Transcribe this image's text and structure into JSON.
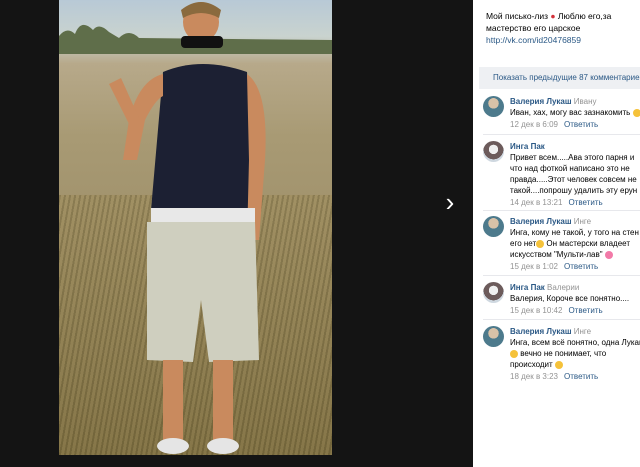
{
  "photo": {
    "alt": ""
  },
  "nav": {
    "next": "›"
  },
  "post": {
    "text_before": "Мой писько-лиз",
    "text_after": "Люблю его,за",
    "text_line2": "мастерство его царское",
    "link": "http://vk.com/id20476859"
  },
  "show_previous": "Показать предыдущие 87 комментариев",
  "comments": [
    {
      "author": "Валерия Лукаш",
      "reply_to": "Ивану",
      "lines": [
        "Иван, хах, могу вас зазнакомить"
      ],
      "date": "12 дек в 6:09",
      "reply": "Ответить"
    },
    {
      "author": "Инга Пак",
      "reply_to": "",
      "lines": [
        "Привет всем.....Ава этого парня и",
        "что над фоткой написано это не",
        "правда.....Этот человек совсем не",
        "такой....попрошу удалить эту ерун"
      ],
      "date": "14 дек в 13:21",
      "reply": "Ответить"
    },
    {
      "author": "Валерия Лукаш",
      "reply_to": "Инге",
      "lines": [
        "Инга, кому не такой, у того на стен",
        "его нет",
        "Он мастерски владеет",
        "искусством \"Мульти-лав\""
      ],
      "date": "15 дек в 1:02",
      "reply": "Ответить"
    },
    {
      "author": "Инга Пак",
      "reply_to": "Валерии",
      "lines": [
        "Валерия, Короче все понятно...."
      ],
      "date": "15 дек в 10:42",
      "reply": "Ответить"
    },
    {
      "author": "Валерия Лукаш",
      "reply_to": "Инге",
      "lines": [
        "Инга, всем всё понятно, одна Лукаш",
        "вечно не понимает, что",
        "происходит"
      ],
      "date": "18 дек в 3:23",
      "reply": "Ответить"
    }
  ]
}
